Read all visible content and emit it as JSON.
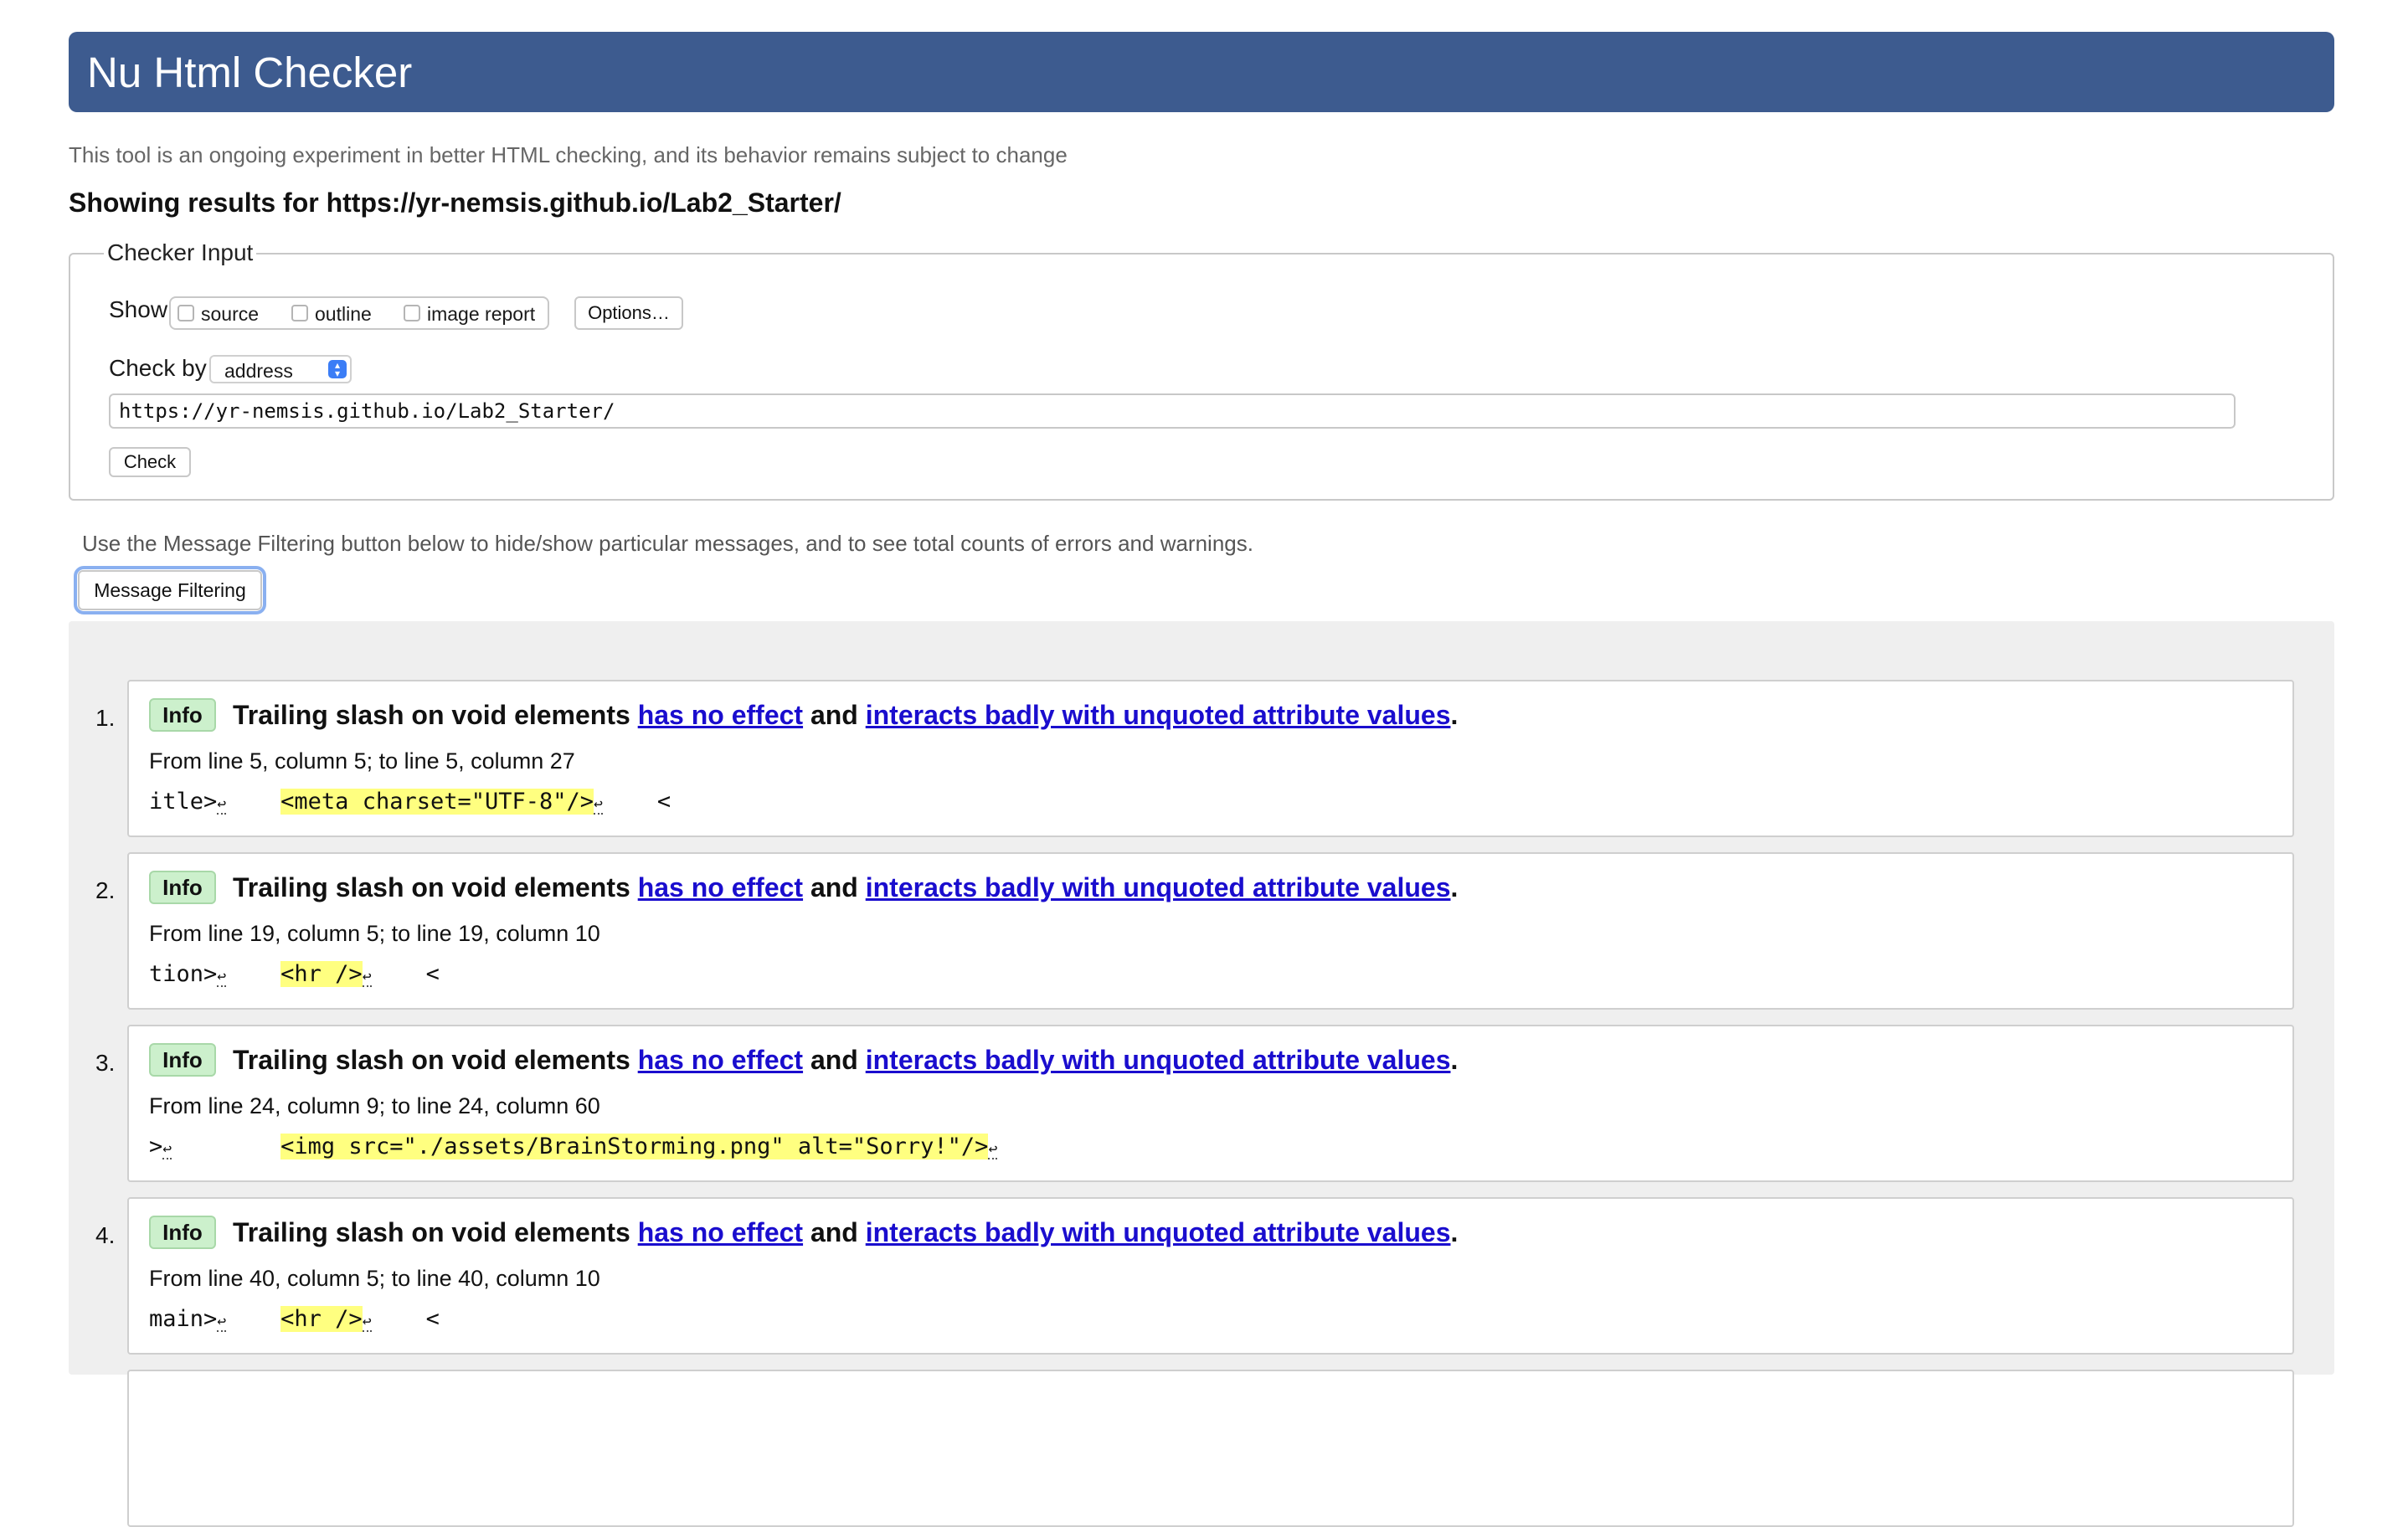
{
  "header": {
    "title": "Nu Html Checker"
  },
  "note": "This tool is an ongoing experiment in better HTML checking, and its behavior remains subject to change",
  "showing": "Showing results for https://yr-nemsis.github.io/Lab2_Starter/",
  "checker_input": {
    "legend": "Checker Input",
    "show_label": "Show",
    "show_options": [
      "source",
      "outline",
      "image report"
    ],
    "options_button": "Options…",
    "check_by_label": "Check by",
    "check_by_value": "address",
    "url_value": "https://yr-nemsis.github.io/Lab2_Starter/",
    "check_button": "Check"
  },
  "filter_note": "Use the Message Filtering button below to hide/show particular messages, and to see total counts of errors and warnings.",
  "filter_button": "Message Filtering",
  "messages": [
    {
      "num": "1.",
      "type": "Info",
      "title_start": "Trailing slash on void elements",
      "link1": "has no effect",
      "middle": "and",
      "link2": "interacts badly with unquoted attribute values",
      "end": ".",
      "location": "From line 5, column 5; to line 5, column 27",
      "code_before": "itle>",
      "code_mid_gap": "    ",
      "code_highlight": "<meta charset=\"UTF-8\"/>",
      "code_after": "    <"
    },
    {
      "num": "2.",
      "type": "Info",
      "title_start": "Trailing slash on void elements",
      "link1": "has no effect",
      "middle": "and",
      "link2": "interacts badly with unquoted attribute values",
      "end": ".",
      "location": "From line 19, column 5; to line 19, column 10",
      "code_before": "tion>",
      "code_mid_gap": "    ",
      "code_highlight": "<hr />",
      "code_after": "    <"
    },
    {
      "num": "3.",
      "type": "Info",
      "title_start": "Trailing slash on void elements",
      "link1": "has no effect",
      "middle": "and",
      "link2": "interacts badly with unquoted attribute values",
      "end": ".",
      "location": "From line 24, column 9; to line 24, column 60",
      "code_before": ">",
      "code_mid_gap": "        ",
      "code_highlight": "<img src=\"./assets/BrainStorming.png\" alt=\"Sorry!\"/>",
      "code_after": ""
    },
    {
      "num": "4.",
      "type": "Info",
      "title_start": "Trailing slash on void elements",
      "link1": "has no effect",
      "middle": "and",
      "link2": "interacts badly with unquoted attribute values",
      "end": ".",
      "location": "From line 40, column 5; to line 40, column 10",
      "code_before": "main>",
      "code_mid_gap": "    ",
      "code_highlight": "<hr />",
      "code_after": "    <"
    }
  ],
  "line_feed_symbol": "↩"
}
